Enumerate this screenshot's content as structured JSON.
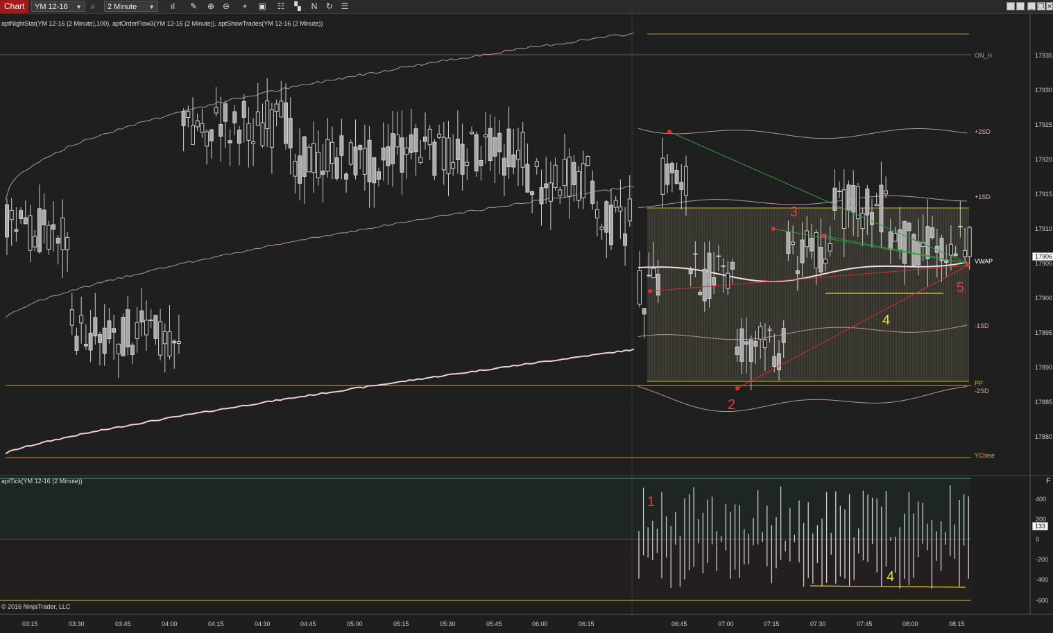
{
  "toolbar": {
    "chart_tab": "Chart",
    "instrument": "YM 12-16",
    "interval": "2 Minute",
    "icons": [
      "search-icon",
      "bar-style-icon",
      "pencil-icon",
      "zoom-in-icon",
      "zoom-out-icon",
      "crosshair-icon",
      "properties-icon",
      "indicators-icon",
      "strategies-icon",
      "drawing-tools-icon",
      "refresh-icon",
      "list-icon"
    ]
  },
  "window_buttons": [
    "tile-icon",
    "tile-icon",
    "minimize-icon",
    "restore-icon",
    "close-icon"
  ],
  "main_panel": {
    "indicator_label": "aptNightStat(YM 12-16 (2 Minute),100), aptOrderFlow3(YM 12-16 (2 Minute)), aptShowTrades(YM 12-16 (2 Minute))",
    "level_labels": [
      {
        "text": "ON_H",
        "color": "#b0a0a0",
        "price": 17935
      },
      {
        "text": "+2SD",
        "color": "#d8b0b0",
        "price": 17924
      },
      {
        "text": "+1SD",
        "color": "#d8b0b0",
        "price": 17914.6
      },
      {
        "text": "VWAP",
        "color": "#ffffff",
        "price": 17905.3
      },
      {
        "text": "-1SD",
        "color": "#d8b0b0",
        "price": 17896
      },
      {
        "text": "PP",
        "color": "#d8b040",
        "price": 17887.7
      },
      {
        "text": "-2SD",
        "color": "#d8b0b0",
        "price": 17886.6
      },
      {
        "text": "YClose",
        "color": "#e8a040",
        "price": 17877.3
      }
    ],
    "price_ticks": [
      "17935",
      "17930",
      "17925",
      "17920",
      "17915",
      "17910",
      "17905",
      "17900",
      "17895",
      "17890",
      "17885",
      "17880"
    ],
    "current_price": "17906",
    "annotations": [
      {
        "text": "2",
        "color": "#e83a3a"
      },
      {
        "text": "3",
        "color": "#e83a3a"
      },
      {
        "text": "4",
        "color": "#f0e030"
      },
      {
        "text": "5",
        "color": "#e83a3a"
      }
    ]
  },
  "tick_panel": {
    "indicator_label": "aptTick(YM 12-16 (2 Minute))",
    "axis_ticks": [
      "400",
      "200",
      "0",
      "-200",
      "-400",
      "-600"
    ],
    "current_value": "133",
    "corner_label": "F",
    "annotations": [
      {
        "text": "1",
        "color": "#e83a3a"
      },
      {
        "text": "4",
        "color": "#f0e030"
      }
    ]
  },
  "time_ticks": [
    "03:15",
    "03:30",
    "03:45",
    "04:00",
    "04:15",
    "04:30",
    "04:45",
    "05:00",
    "05:15",
    "05:30",
    "05:45",
    "06:00",
    "06:15",
    "06:45",
    "07:00",
    "07:15",
    "07:30",
    "07:45",
    "08:00",
    "08:15"
  ],
  "copyright": "© 2016 NinjaTrader, LLC"
}
